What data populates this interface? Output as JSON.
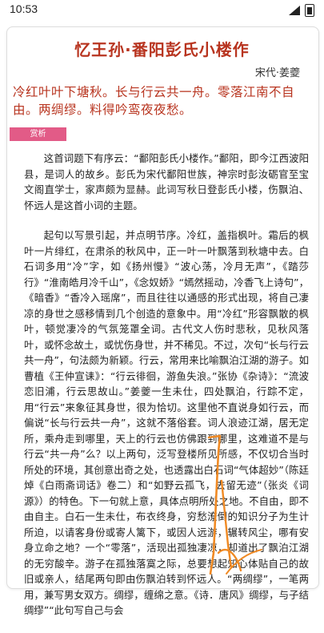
{
  "status": {
    "time": "10:53"
  },
  "header": {
    "title": "忆王孙·番阳彭氏小楼作",
    "author": "宋代·姜夔"
  },
  "poem": "冷红叶叶下塘秋。长与行云共一舟。零落江南不自由。两绸缪。料得吟鸾夜夜愁。",
  "tag_label": "赏析",
  "appreciation": [
    "这首词题下有序云：“鄱阳彭氏小楼作。”鄱阳，即今江西波阳县，是词人的故乡。彭氏为宋代鄱阳世族，神宗时彭汝砺官至宝文阁直学士，家声颇为显赫。此词写秋日登彭氏小楼，伤飘泊、怀远人是这首小词的主题。",
    "起句以写景引起，并点明节序。冷红，盖指枫叶。霜后的枫叶一片绯红，在肃杀的秋风中，正一叶一叶飘落到秋塘中去。白石词多用“冷”字，如《扬州慢》“波心荡，冷月无声”，《踏莎行》“淮南皓月冷千山”，《念奴娇》“嫣然摇动，冷香飞上诗句”，《暗香》“香冷入瑶席”，而且往往以通感的形式出现，将自己凄凉的身世之感移情到几个创造的意象中。用“冷红”形容飘散的枫叶，顿觉凄冷的气氛笼罩全词。古代文人伤时悲秋，见秋风落叶，或怀念故土，或忧伤身世，并不稀见。不过，次句“长与行云共一舟”，句法颇为新颖。行云，常用来比喻飘泊江湖的游子。如曹植《王仲宣诔》：“行云徘徊，游鱼失浪。”张协《杂诗》：“流波恋旧浦，行云思故山。”姜夔一生未仕，四处飘泊，行踪不定，用“行云”来象征其身世，很为恰切。这里他不直说身如行云，而偏说“长与行云共一舟”，这就不落俗套。词人浪迹江湖，居无定所，乘舟走到哪里，天上的行云也仿佛跟到哪里，这难道不是与行云“共一舟”么？以上两句，泛写登楼所见所感，不仅切合当时所处的环境，其创意出奇之处，也透露出白石词“气体超妙”（陈廷焯《白雨斋词话》卷二）和“如野云孤飞，去留无迹”（张炎《词源》）的特色。下一句就上意，具体点明所处之地。不自由，即不由自主。白石一生未仕，布衣终身，穷愁潦倒的知识分子为生计所迫，以请客身份或寄人篱下，或因人远游，辗转风尘，哪有安身立命之地？一个“零落”，活现出孤独凄凉，却道出了飘泊江湖的无穷酸辛。游子在孤独落寞之际，总要想起知心体贴自己的故旧或亲人，结尾两句即由伤飘泊转到怀远人。“两绸缪”，一笔两用，兼写男女双方。绸缪，缠绵之意。《诗．唐风》绸缪，与子结绸缪”“此句写自己与会"
  ]
}
